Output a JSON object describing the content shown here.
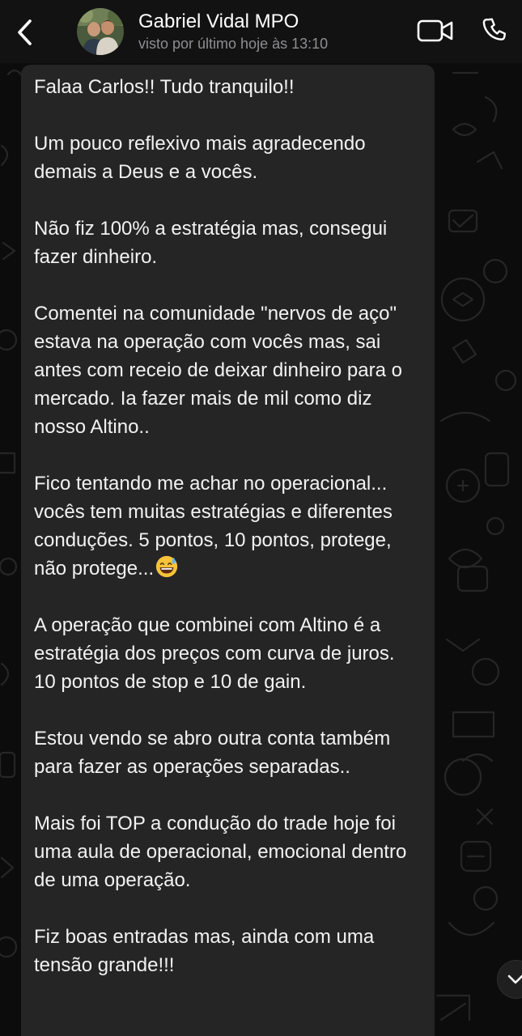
{
  "header": {
    "contact_name": "Gabriel Vidal MPO",
    "status": "visto por último hoje às 13:10",
    "back_icon": "chevron-left-icon",
    "video_icon": "video-camera-icon",
    "call_icon": "phone-icon"
  },
  "message": {
    "paragraphs": [
      "Falaa Carlos!! Tudo tranquilo!!",
      "Um pouco reflexivo mais agradecendo demais a Deus e a vocês.",
      "Não fiz 100% a estratégia mas, consegui  fazer dinheiro.",
      "Comentei na comunidade \"nervos de aço\" estava na operação com vocês mas, sai antes com receio de deixar dinheiro para o mercado. Ia fazer mais de mil como diz nosso Altino..",
      "Fico tentando me achar no operacional... vocês tem muitas estratégias e diferentes conduções. 5 pontos, 10 pontos, protege, não protege...",
      "A operação que combinei com Altino é a estratégia dos preços com curva de juros. 10 pontos de stop e 10 de gain.",
      "Estou vendo se abro outra conta também para fazer as operações separadas..",
      "Mais foi TOP a condução  do trade hoje foi uma aula de operacional, emocional dentro de uma operação.",
      "Fiz boas entradas mas, ainda com uma tensão grande!!!"
    ],
    "emoji": "grinning-sweat-emoji"
  },
  "scroll_button_icon": "chevron-down-icon",
  "colors": {
    "header_bg": "#121212",
    "bubble_bg": "#252526",
    "text": "#f2f2f2",
    "status_text": "#8e8e93"
  }
}
